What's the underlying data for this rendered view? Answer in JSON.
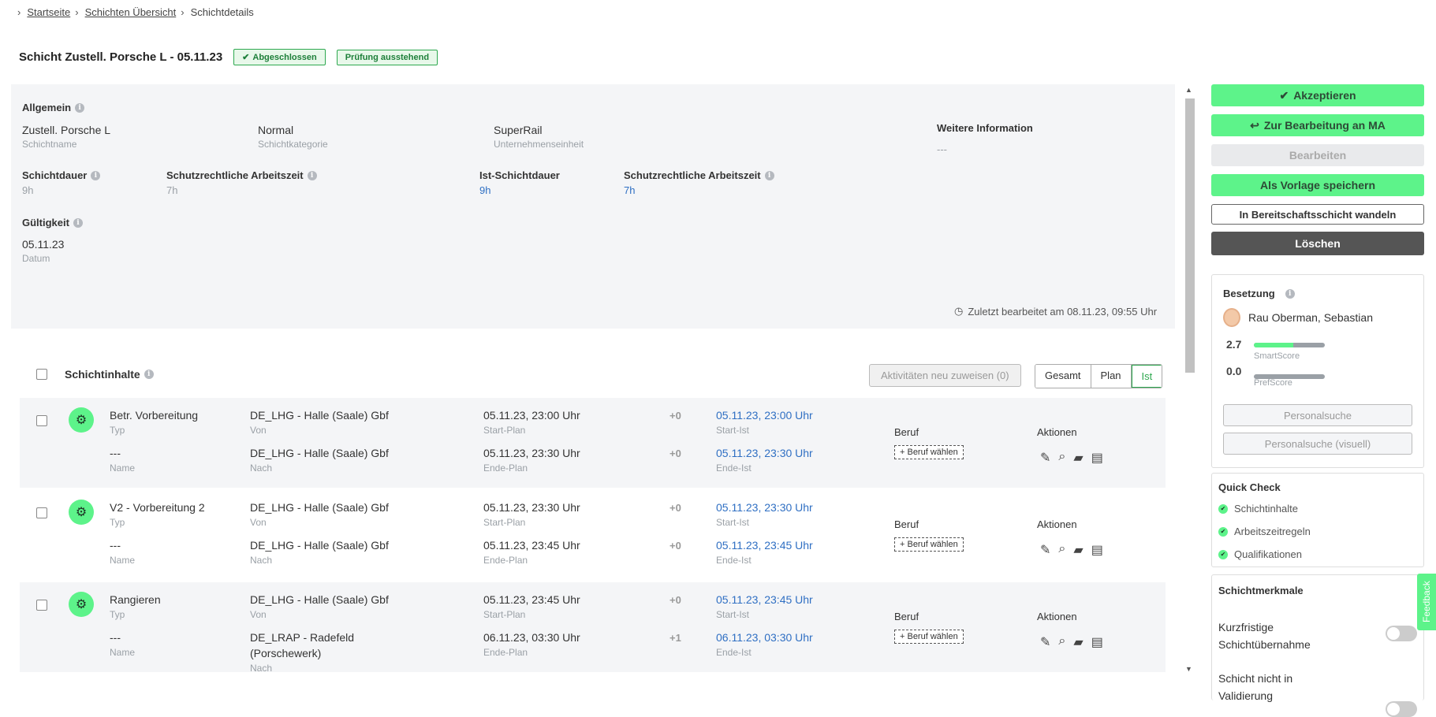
{
  "breadcrumb": {
    "home": "Startseite",
    "overview": "Schichten Übersicht",
    "current": "Schichtdetails"
  },
  "title": "Schicht Zustell. Porsche L - 05.11.23",
  "badges": {
    "status": "Abgeschlossen",
    "review": "Prüfung ausstehend"
  },
  "general": {
    "label": "Allgemein",
    "shift_name": "Zustell. Porsche L",
    "shift_name_label": "Schichtname",
    "category": "Normal",
    "category_label": "Schichtkategorie",
    "unit": "SuperRail",
    "unit_label": "Unternehmenseinheit",
    "more_info_label": "Weitere Information",
    "more_info": "---",
    "duration_label": "Schichtdauer",
    "duration": "9h",
    "protected_label": "Schutzrechtliche Arbeitszeit",
    "protected": "7h",
    "actual_duration_label": "Ist-Schichtdauer",
    "actual_duration": "9h",
    "actual_protected_label": "Schutzrechtliche Arbeitszeit",
    "actual_protected": "7h",
    "validity_label": "Gültigkeit",
    "date": "05.11.23",
    "date_label": "Datum",
    "last_edited": "Zuletzt bearbeitet am 08.11.23, 09:55 Uhr"
  },
  "contents": {
    "label": "Schichtinhalte",
    "reassign": "Aktivitäten neu zuweisen (0)",
    "views": [
      "Gesamt",
      "Plan",
      "Ist"
    ],
    "labels": {
      "typ": "Typ",
      "name": "Name",
      "von": "Von",
      "nach": "Nach",
      "start_plan": "Start-Plan",
      "end_plan": "Ende-Plan",
      "start_ist": "Start-Ist",
      "end_ist": "Ende-Ist",
      "beruf": "Beruf",
      "aktionen": "Aktionen",
      "beruf_btn": "+ Beruf wählen"
    },
    "rows": [
      {
        "type": "Betr. Vorbereitung",
        "name": "---",
        "from": "DE_LHG - Halle (Saale) Gbf",
        "to": "DE_LHG - Halle (Saale) Gbf",
        "to2": "",
        "start_plan": "05.11.23, 23:00 Uhr",
        "end_plan": "05.11.23, 23:30 Uhr",
        "d1": "+0",
        "d2": "+0",
        "start_ist": "05.11.23, 23:00 Uhr",
        "end_ist": "05.11.23, 23:30 Uhr"
      },
      {
        "type": "V2 - Vorbereitung 2",
        "name": "---",
        "from": "DE_LHG - Halle (Saale) Gbf",
        "to": "DE_LHG - Halle (Saale) Gbf",
        "to2": "",
        "start_plan": "05.11.23, 23:30 Uhr",
        "end_plan": "05.11.23, 23:45 Uhr",
        "d1": "+0",
        "d2": "+0",
        "start_ist": "05.11.23, 23:30 Uhr",
        "end_ist": "05.11.23, 23:45 Uhr"
      },
      {
        "type": "Rangieren",
        "name": "---",
        "from": "DE_LHG - Halle (Saale) Gbf",
        "to": "DE_LRAP - Radefeld",
        "to2": "(Porschewerk)",
        "start_plan": "05.11.23, 23:45 Uhr",
        "end_plan": "06.11.23, 03:30 Uhr",
        "d1": "+0",
        "d2": "+1",
        "start_ist": "05.11.23, 23:45 Uhr",
        "end_ist": "06.11.23, 03:30 Uhr"
      }
    ]
  },
  "sidebar": {
    "accept": "Akzeptieren",
    "return": "Zur Bearbeitung an MA",
    "edit": "Bearbeiten",
    "template": "Als Vorlage speichern",
    "convert": "In Bereitschaftsschicht wandeln",
    "delete": "Löschen",
    "staffing_label": "Besetzung",
    "employee": "Rau Oberman, Sebastian",
    "smart_score": "2.7",
    "smart_label": "SmartScore",
    "smart_fraction": 0.55,
    "pref_score": "0.0",
    "pref_label": "PrefScore",
    "pref_fraction": 0.0,
    "search": "Personalsuche",
    "search_visual": "Personalsuche (visuell)",
    "quick_check": "Quick Check",
    "checks": [
      "Schichtinhalte",
      "Arbeitszeitregeln",
      "Qualifikationen"
    ],
    "features": "Schichtmerkmale",
    "short_takeover_1": "Kurzfristige",
    "short_takeover_2": "Schichtübernahme",
    "not_validation_1": "Schicht nicht in",
    "not_validation_2": "Validierung",
    "feedback": "Feedback"
  },
  "colors": {
    "accent": "#5df38a",
    "link_blue": "#2f6fc3",
    "badge_green": "#2ea84f"
  }
}
